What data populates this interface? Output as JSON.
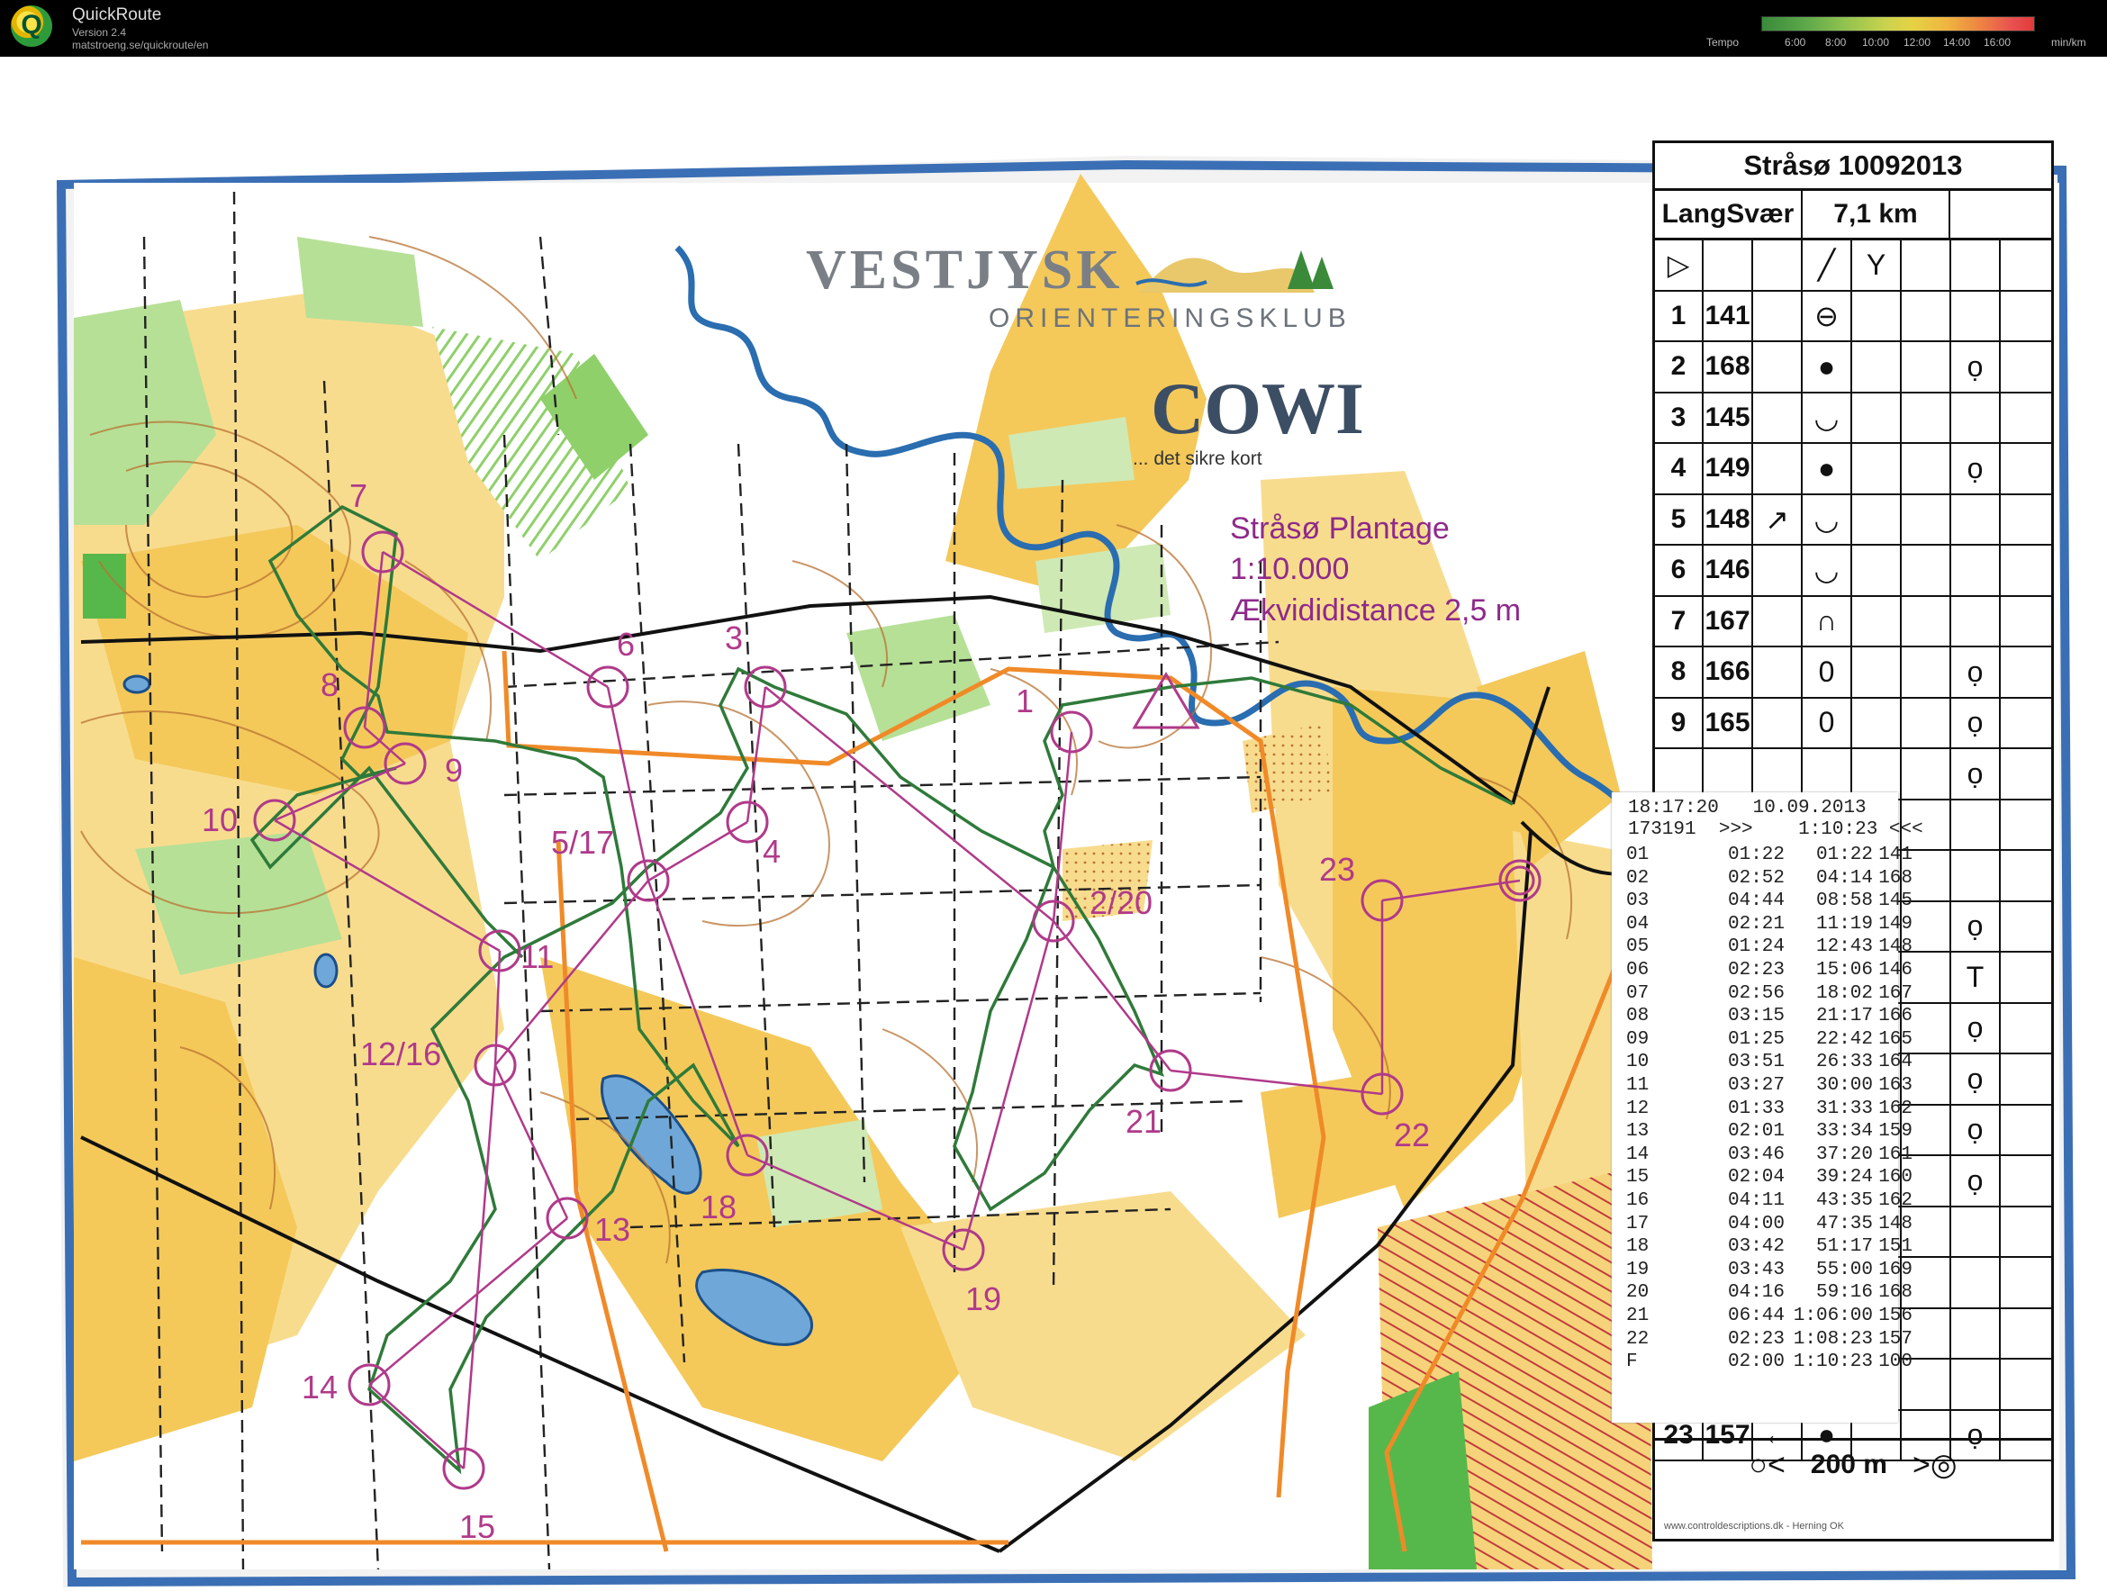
{
  "app": {
    "logo_letter": "Q",
    "title": "QuickRoute",
    "version": "Version 2.4",
    "url": "matstroeng.se/quickroute/en"
  },
  "tempo_scale": {
    "label": "Tempo",
    "ticks": [
      "6:00",
      "8:00",
      "10:00",
      "12:00",
      "14:00",
      "16:00"
    ],
    "unit": "min/km",
    "colors": [
      "#3a8a3a",
      "#8fc24f",
      "#e6d245",
      "#ee8442",
      "#e23a3a"
    ]
  },
  "map": {
    "club_name": "VESTJYSK",
    "club_subtitle": "ORIENTERINGSKLUB",
    "sponsor": "COWI",
    "sponsor_tagline": "... det sikre kort",
    "area_name": "Stråsø Plantage",
    "scale": "1:10.000",
    "contour_interval": "Ækvididistance 2,5 m",
    "colors": {
      "forest": "#ffffff",
      "open_land": "#f4c95a",
      "rough_open": "#f8dc8e",
      "green": "#8fd06a",
      "water": "#2a6db0",
      "contours": "#b87333",
      "course": "#b03a8a",
      "route": "#2f7a3a",
      "boundary": "#f08a28",
      "frame": "#3b6fb5"
    },
    "controls": [
      {
        "label": "7"
      },
      {
        "label": "8"
      },
      {
        "label": "9"
      },
      {
        "label": "10"
      },
      {
        "label": "6"
      },
      {
        "label": "3"
      },
      {
        "label": "1"
      },
      {
        "label": "5/17"
      },
      {
        "label": "4"
      },
      {
        "label": "2/20"
      },
      {
        "label": "23"
      },
      {
        "label": "11"
      },
      {
        "label": "12/16"
      },
      {
        "label": "21"
      },
      {
        "label": "22"
      },
      {
        "label": "18"
      },
      {
        "label": "13"
      },
      {
        "label": "19"
      },
      {
        "label": "14"
      },
      {
        "label": "15"
      }
    ]
  },
  "description_sheet": {
    "title": "Stråsø 10092013",
    "course_name": "LangSvær",
    "course_length": "7,1 km",
    "start_symbol": "▷",
    "header_symbols": [
      "╱",
      "Y"
    ],
    "rows": [
      {
        "num": "1",
        "code": "141",
        "dir": "",
        "feature": "⊖",
        "extra": ""
      },
      {
        "num": "2",
        "code": "168",
        "dir": "",
        "feature": "●",
        "extra": "ọ"
      },
      {
        "num": "3",
        "code": "145",
        "dir": "",
        "feature": "◡",
        "extra": ""
      },
      {
        "num": "4",
        "code": "149",
        "dir": "",
        "feature": "●",
        "extra": "ọ"
      },
      {
        "num": "5",
        "code": "148",
        "dir": "↗",
        "feature": "◡",
        "extra": ""
      },
      {
        "num": "6",
        "code": "146",
        "dir": "",
        "feature": "◡",
        "extra": ""
      },
      {
        "num": "7",
        "code": "167",
        "dir": "",
        "feature": "∩",
        "extra": ""
      },
      {
        "num": "8",
        "code": "166",
        "dir": "",
        "feature": "0",
        "extra": "ọ"
      },
      {
        "num": "9",
        "code": "165",
        "dir": "",
        "feature": "0",
        "extra": "ọ"
      }
    ],
    "last_row": {
      "num": "23",
      "code": "157",
      "dir": "←",
      "feature": "●",
      "extra": "ọ"
    },
    "side_symbols": [
      "ọ",
      "ọ",
      "T",
      "ọ",
      "ọ",
      "ọ",
      "ọ"
    ],
    "scale_text": "200 m",
    "scale_left": "○<",
    "scale_right": ">◎",
    "credit": "www.controldescriptions.dk - Herning OK"
  },
  "splits": {
    "time": "18:17:20",
    "date": "10.09.2013",
    "card": "173191",
    "card_sep": ">>>",
    "total": "1:10:23",
    "total_sep": "<<<",
    "rows": [
      {
        "code": "01",
        "leg": "01:22",
        "cum": "01:22",
        "pace": "141"
      },
      {
        "code": "02",
        "leg": "02:52",
        "cum": "04:14",
        "pace": "168"
      },
      {
        "code": "03",
        "leg": "04:44",
        "cum": "08:58",
        "pace": "145"
      },
      {
        "code": "04",
        "leg": "02:21",
        "cum": "11:19",
        "pace": "149"
      },
      {
        "code": "05",
        "leg": "01:24",
        "cum": "12:43",
        "pace": "148"
      },
      {
        "code": "06",
        "leg": "02:23",
        "cum": "15:06",
        "pace": "146"
      },
      {
        "code": "07",
        "leg": "02:56",
        "cum": "18:02",
        "pace": "167"
      },
      {
        "code": "08",
        "leg": "03:15",
        "cum": "21:17",
        "pace": "166"
      },
      {
        "code": "09",
        "leg": "01:25",
        "cum": "22:42",
        "pace": "165"
      },
      {
        "code": "10",
        "leg": "03:51",
        "cum": "26:33",
        "pace": "164"
      },
      {
        "code": "11",
        "leg": "03:27",
        "cum": "30:00",
        "pace": "163"
      },
      {
        "code": "12",
        "leg": "01:33",
        "cum": "31:33",
        "pace": "162"
      },
      {
        "code": "13",
        "leg": "02:01",
        "cum": "33:34",
        "pace": "159"
      },
      {
        "code": "14",
        "leg": "03:46",
        "cum": "37:20",
        "pace": "161"
      },
      {
        "code": "15",
        "leg": "02:04",
        "cum": "39:24",
        "pace": "160"
      },
      {
        "code": "16",
        "leg": "04:11",
        "cum": "43:35",
        "pace": "162"
      },
      {
        "code": "17",
        "leg": "04:00",
        "cum": "47:35",
        "pace": "148"
      },
      {
        "code": "18",
        "leg": "03:42",
        "cum": "51:17",
        "pace": "151"
      },
      {
        "code": "19",
        "leg": "03:43",
        "cum": "55:00",
        "pace": "169"
      },
      {
        "code": "20",
        "leg": "04:16",
        "cum": "59:16",
        "pace": "168"
      },
      {
        "code": "21",
        "leg": "06:44",
        "cum": "1:06:00",
        "pace": "156"
      },
      {
        "code": "22",
        "leg": "02:23",
        "cum": "1:08:23",
        "pace": "157"
      },
      {
        "code": "F",
        "leg": "02:00",
        "cum": "1:10:23",
        "pace": "100"
      }
    ]
  }
}
